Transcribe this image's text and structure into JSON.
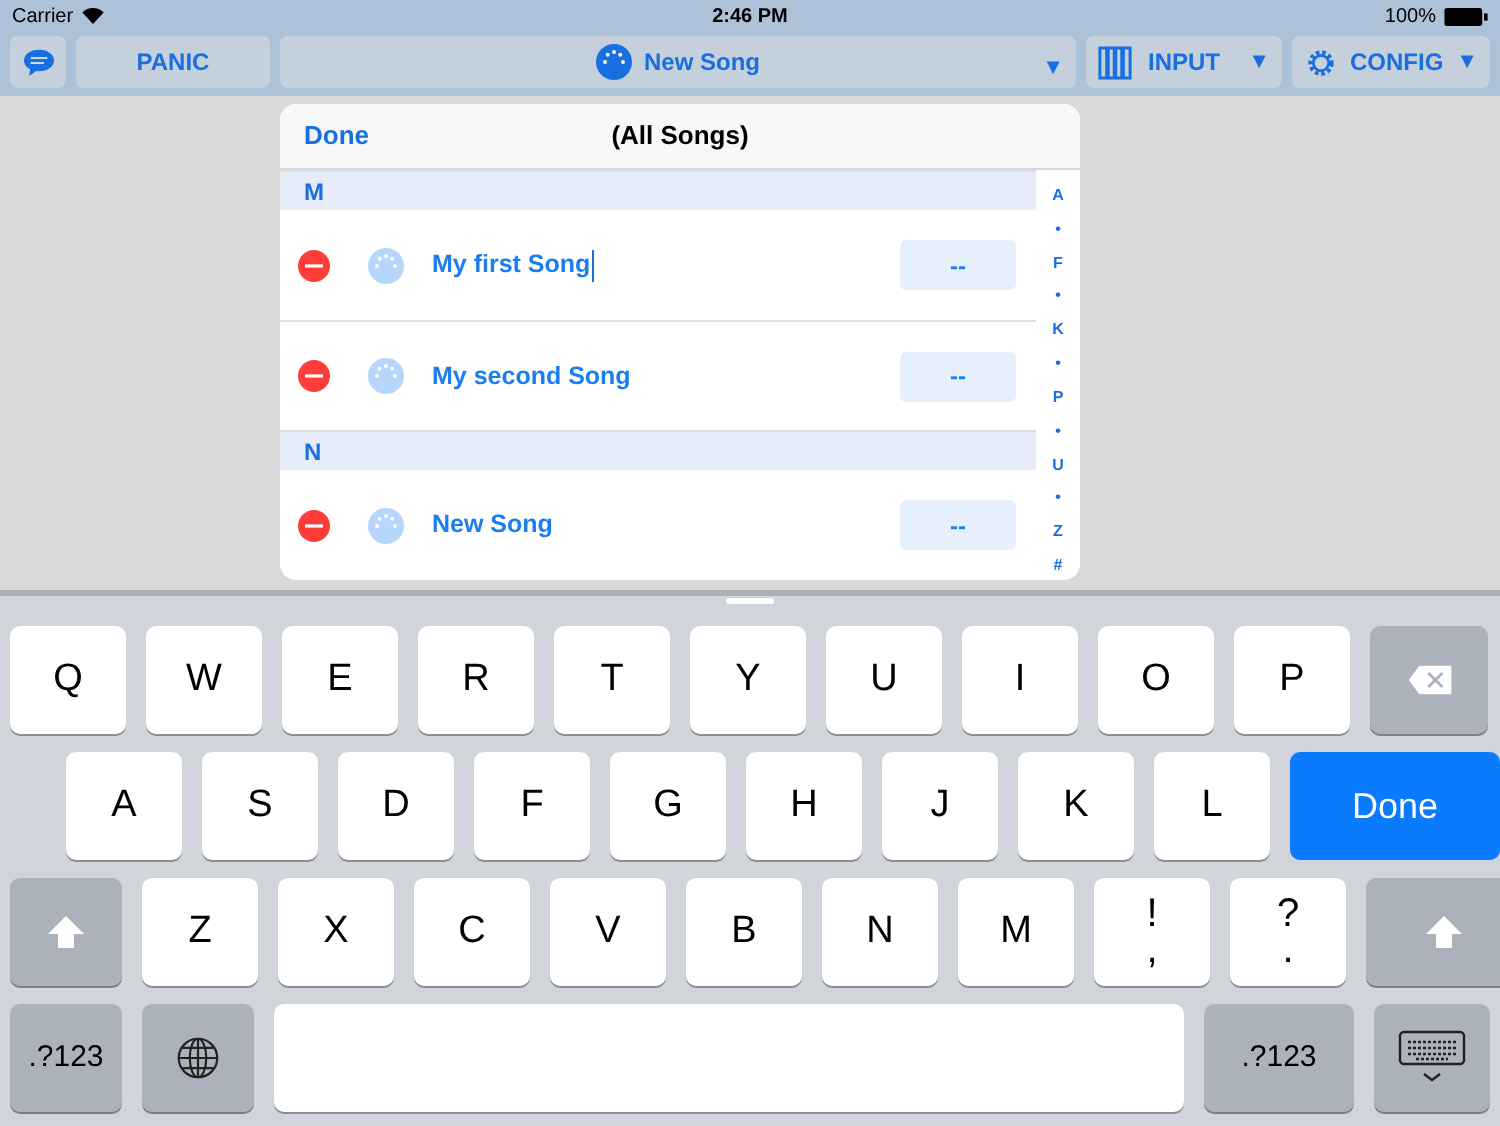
{
  "status_bar": {
    "carrier": "Carrier",
    "time": "2:46 PM",
    "battery": "100%"
  },
  "toolbar": {
    "panic": "PANIC",
    "song": "New Song",
    "input": "INPUT",
    "config": "CONFIG",
    "arrow": "▼"
  },
  "popover": {
    "done": "Done",
    "title": "(All Songs)",
    "sections": [
      {
        "header": "M",
        "rows": [
          {
            "name": "My first Song",
            "value": "--",
            "editing": true
          },
          {
            "name": "My second Song",
            "value": "--",
            "editing": false
          }
        ]
      },
      {
        "header": "N",
        "rows": [
          {
            "name": "New Song",
            "value": "--",
            "editing": false
          }
        ]
      }
    ],
    "index": [
      "A",
      "•",
      "F",
      "•",
      "K",
      "•",
      "P",
      "•",
      "U",
      "•",
      "Z",
      "#"
    ]
  },
  "keyboard": {
    "rows": [
      {
        "keys": [
          {
            "kind": "letter",
            "label": "Q"
          },
          {
            "kind": "letter",
            "label": "W"
          },
          {
            "kind": "letter",
            "label": "E"
          },
          {
            "kind": "letter",
            "label": "R"
          },
          {
            "kind": "letter",
            "label": "T"
          },
          {
            "kind": "letter",
            "label": "Y"
          },
          {
            "kind": "letter",
            "label": "U"
          },
          {
            "kind": "letter",
            "label": "I"
          },
          {
            "kind": "letter",
            "label": "O"
          },
          {
            "kind": "letter",
            "label": "P"
          },
          {
            "kind": "backspace"
          }
        ]
      },
      {
        "keys": [
          {
            "kind": "letter",
            "label": "A"
          },
          {
            "kind": "letter",
            "label": "S"
          },
          {
            "kind": "letter",
            "label": "D"
          },
          {
            "kind": "letter",
            "label": "F"
          },
          {
            "kind": "letter",
            "label": "G"
          },
          {
            "kind": "letter",
            "label": "H"
          },
          {
            "kind": "letter",
            "label": "J"
          },
          {
            "kind": "letter",
            "label": "K"
          },
          {
            "kind": "letter",
            "label": "L"
          },
          {
            "kind": "done",
            "label": "Done"
          }
        ]
      },
      {
        "keys": [
          {
            "kind": "shift"
          },
          {
            "kind": "letter",
            "label": "Z"
          },
          {
            "kind": "letter",
            "label": "X"
          },
          {
            "kind": "letter",
            "label": "C"
          },
          {
            "kind": "letter",
            "label": "V"
          },
          {
            "kind": "letter",
            "label": "B"
          },
          {
            "kind": "letter",
            "label": "N"
          },
          {
            "kind": "letter",
            "label": "M"
          },
          {
            "kind": "dual",
            "label": "!",
            "sub": ","
          },
          {
            "kind": "dual",
            "label": "?",
            "sub": "."
          },
          {
            "kind": "shift_wide"
          }
        ]
      },
      {
        "keys": [
          {
            "kind": "numbers",
            "label": ".?123"
          },
          {
            "kind": "globe"
          },
          {
            "kind": "space"
          },
          {
            "kind": "numbers_wide",
            "label": ".?123"
          },
          {
            "kind": "dismiss"
          }
        ]
      }
    ]
  }
}
